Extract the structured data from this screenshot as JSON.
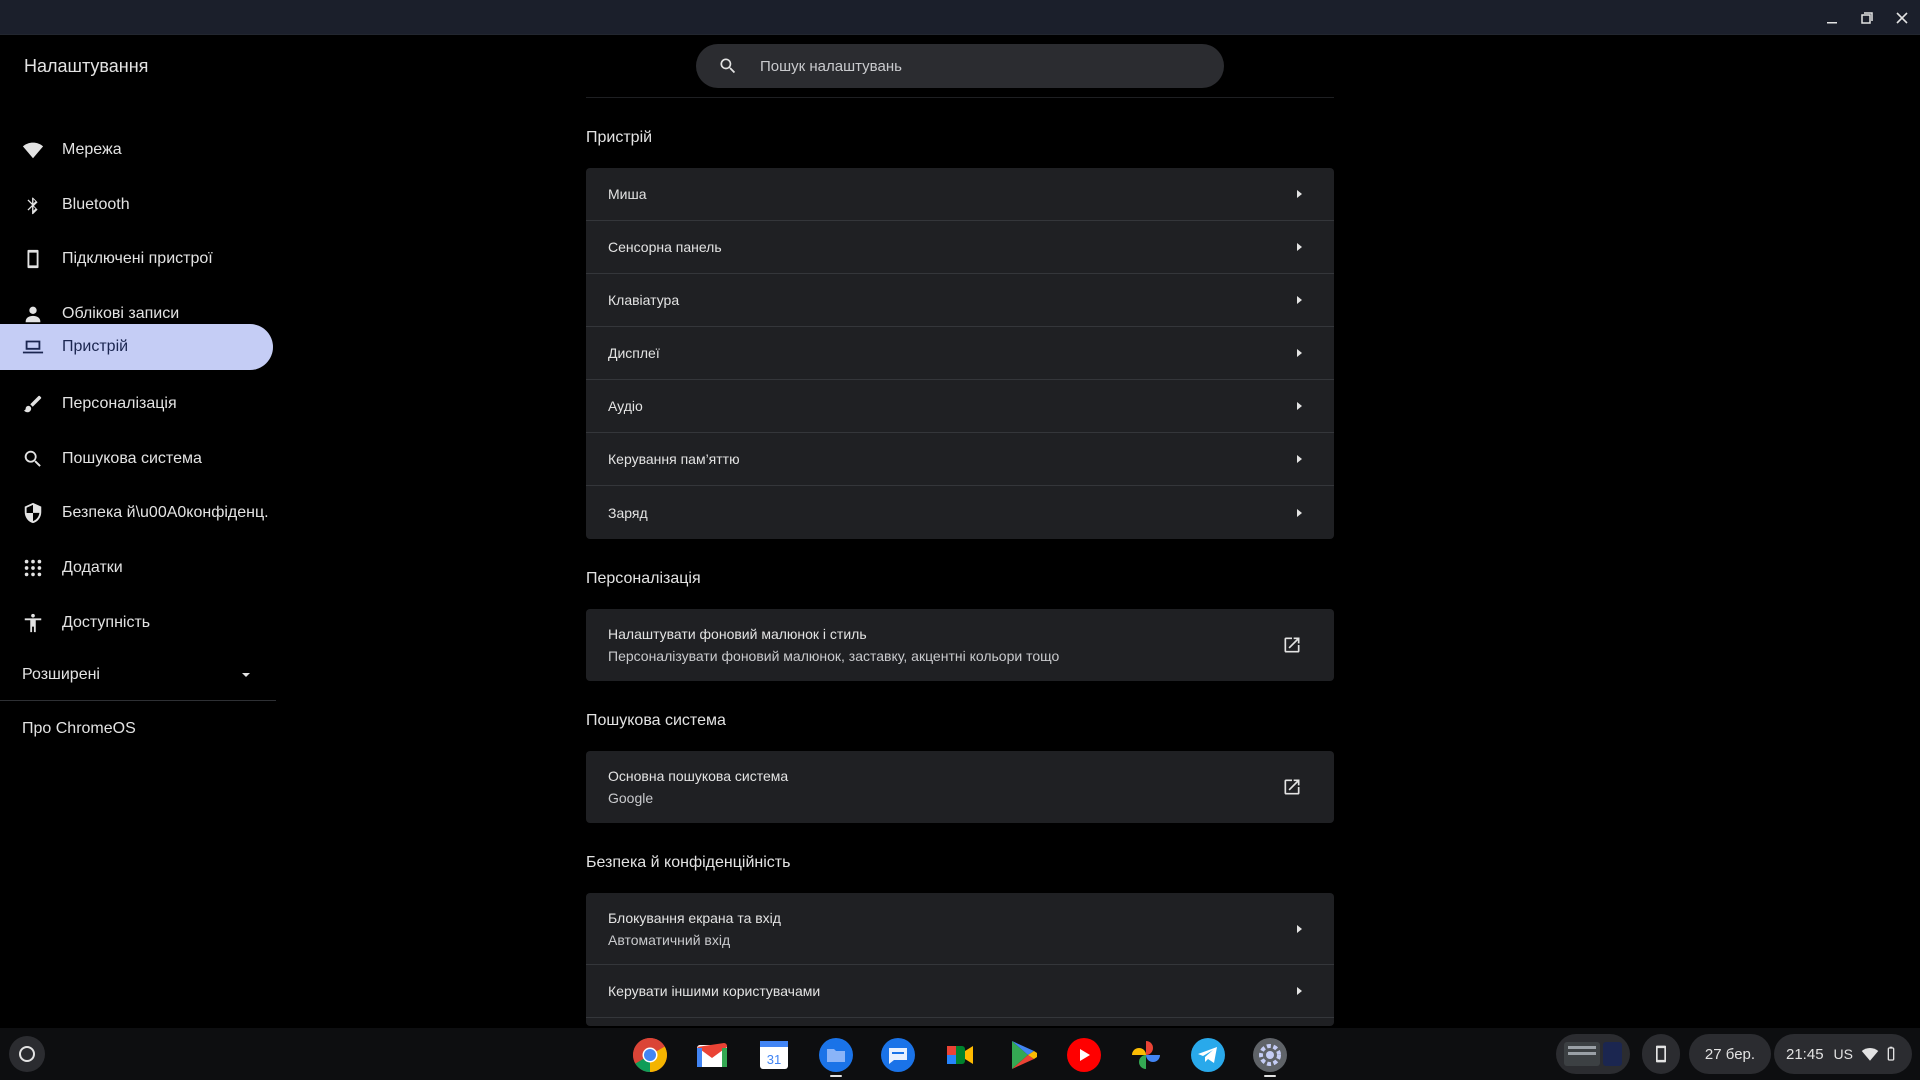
{
  "app": {
    "title": "Налаштування"
  },
  "search": {
    "placeholder": "Пошук налаштувань"
  },
  "sidebar": {
    "items": [
      {
        "label": "Мережа",
        "icon": "wifi-icon"
      },
      {
        "label": "Bluetooth",
        "icon": "bluetooth-icon"
      },
      {
        "label": "Підключені пристрої",
        "icon": "phone-icon"
      },
      {
        "label": "Облікові записи",
        "icon": "person-icon"
      },
      {
        "label": "Пристрій",
        "icon": "laptop-icon",
        "active": true
      },
      {
        "label": "Персоналізація",
        "icon": "brush-icon"
      },
      {
        "label": "Пошукова система",
        "icon": "search-icon"
      },
      {
        "label": "Безпека й\\u00A0конфіденц.",
        "icon": "shield-icon"
      },
      {
        "label": "Додатки",
        "icon": "apps-grid-icon"
      },
      {
        "label": "Доступність",
        "icon": "accessibility-icon"
      }
    ],
    "advanced": "Розширені",
    "about": "Про ChromeOS"
  },
  "sections": {
    "device": {
      "title": "Пристрій",
      "rows": [
        "Миша",
        "Сенсорна панель",
        "Клавіатура",
        "Дисплеї",
        "Аудіо",
        "Керування пам’яттю",
        "Заряд"
      ]
    },
    "personalization": {
      "title": "Персоналізація",
      "row": {
        "label": "Налаштувати фоновий малюнок і стиль",
        "sub": "Персоналізувати фоновий малюнок, заставку, акцентні кольори тощо"
      }
    },
    "search_engine": {
      "title": "Пошукова система",
      "row": {
        "label": "Основна пошукова система",
        "sub": "Google"
      }
    },
    "security": {
      "title": "Безпека й конфіденційність",
      "rows": [
        {
          "label": "Блокування екрана та вхід",
          "sub": "Автоматичний вхід"
        },
        {
          "label": "Керувати іншими користувачами"
        }
      ]
    }
  },
  "shelf": {
    "apps": [
      "chrome-icon",
      "gmail-icon",
      "calendar-icon",
      "files-icon",
      "messages-icon",
      "meet-icon",
      "play-store-icon",
      "youtube-icon",
      "photos-icon",
      "telegram-icon",
      "settings-icon"
    ],
    "calendar_day": "31",
    "date": "27 бер.",
    "time": "21:45",
    "keyboard_layout": "US"
  },
  "colors": {
    "accent": "#c5cdf5",
    "background": "#000000",
    "card": "#1f2023"
  }
}
